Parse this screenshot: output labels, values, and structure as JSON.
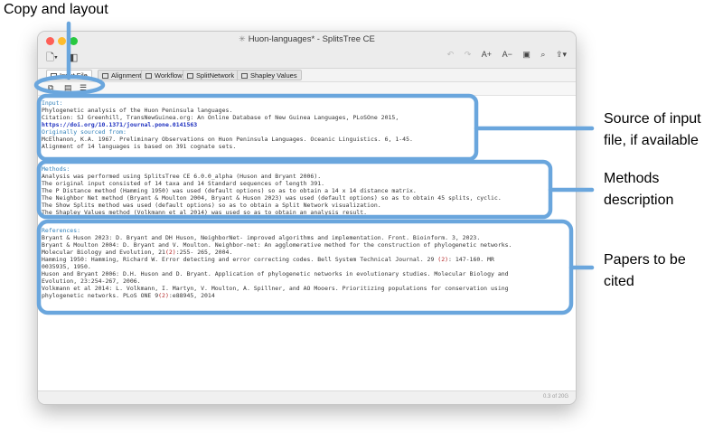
{
  "annotations": {
    "copy_and_layout": "Copy and layout",
    "source_line1": "Source of input",
    "source_line2": "file, if available",
    "methods_line1": "Methods",
    "methods_line2": "description",
    "papers_line1": "Papers to be",
    "papers_line2": "cited"
  },
  "window": {
    "title": "Huon-languages* - SplitsTree CE",
    "status": "0.3 of 20G"
  },
  "tabs": [
    {
      "label": "Input File"
    },
    {
      "label": "Alignment"
    },
    {
      "label": "Workflow"
    },
    {
      "label": "SplitNetwork"
    },
    {
      "label": "Shapley Values"
    }
  ],
  "toolbar": {
    "font_increase": "A+",
    "font_decrease": "A−"
  },
  "input": {
    "header": "Input:",
    "line1": "Phylogenetic analysis of the Huon Peninsula languages.",
    "line2": "Citation: SJ Greenhill, TransNewGuinea.org: An Online Database of New Guinea Languages, PLoSOne 2015,",
    "doi": "https://doi.org/10.1371/journal.pone.0141563",
    "sourced_header": "Originally sourced from:",
    "line3": "McElhanon, K.A. 1967. Preliminary Observations on Huon Peninsula Languages. Oceanic Linguistics. 6, 1-45.",
    "line4": "Alignment of 14 languages is based on 391 cognate sets."
  },
  "methods": {
    "header": "Methods:",
    "line1": "Analysis was performed using SplitsTree CE 6.0.0_alpha (Huson and Bryant 2006).",
    "line2": "The original input consisted of 14 taxa and 14 Standard sequences of length 391.",
    "line3": "The P Distance method (Hamming 1950) was used (default options) so as to obtain a 14 x 14 distance matrix.",
    "line4": "The Neighbor Net method (Bryant & Moulton 2004, Bryant & Huson 2023) was used (default options) so as to obtain 45 splits, cyclic.",
    "line5": "The Show Splits method was used (default options) so as to obtain a Split Network visualization.",
    "line6": "The Shapley Values method (Volkmann et al 2014) was used so as to obtain an analysis result."
  },
  "references": {
    "header": "References:",
    "r1": "Bryant & Huson 2023: D. Bryant and DH Huson, NeighborNet- improved algorithms and implementation. Front. Bioinform. 3, 2023.",
    "r2a": "Bryant & Moulton 2004: D. Bryant and V. Moulton. Neighbor-net: An agglomerative method for the construction of phylogenetic networks.",
    "r2b_pre": "Molecular Biology and Evolution, 21",
    "r2b_num": "(2)",
    "r2b_post": ":255- 265, 2004.",
    "r3a_pre": "Hamming 1950: Hamming, Richard W. Error detecting and error correcting codes. Bell System Technical Journal. 29 ",
    "r3a_num": "(2)",
    "r3a_post": ": 147-160. MR",
    "r3b": "0035935, 1950.",
    "r4a": "Huson and Bryant 2006: D.H. Huson and D. Bryant. Application of phylogenetic networks in evolutionary studies. Molecular Biology and",
    "r4b": "Evolution, 23:254-267, 2006.",
    "r5a": "Volkmann et al 2014: L. Volkmann, I. Martyn, V. Moulton, A. Spillner, and AO Mooers. Prioritizing populations for conservation using",
    "r5b_pre": "phylogenetic networks. PLoS ONE 9",
    "r5b_num": "(2)",
    "r5b_post": ":e88945, 2014"
  },
  "colors": {
    "highlight": "#6aa6dd",
    "header_text": "#2f7fb8",
    "doi_text": "#1d2fbf"
  },
  "icons": [
    "new-document-icon",
    "sidebar-icon",
    "undo-icon",
    "redo-icon",
    "zoom-icon",
    "search-icon",
    "share-icon",
    "copy-icon",
    "layout-icon",
    "list-icon"
  ]
}
